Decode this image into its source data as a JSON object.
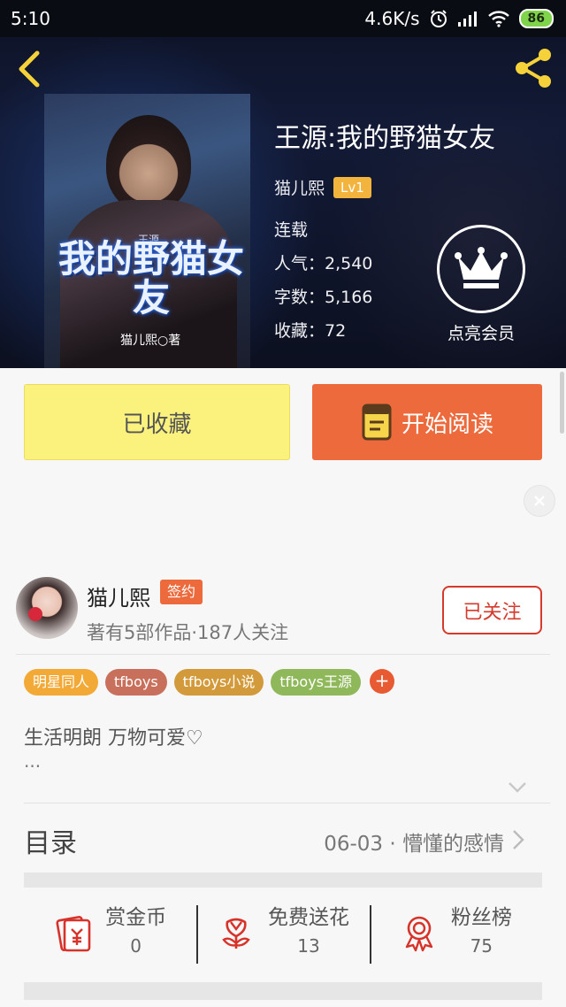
{
  "status_bar": {
    "time": "5:10",
    "network_speed": "4.6K/s",
    "battery": "86"
  },
  "book": {
    "cover_subtitle": "王源",
    "cover_title": "我的野猫女友",
    "cover_author": "猫儿熙○著",
    "title": "王源:我的野猫女友",
    "author": "猫儿熙",
    "level": "Lv1",
    "status": "连载",
    "popularity": "人气：2,540",
    "word_count": "字数：5,166",
    "favorites": "收藏：72"
  },
  "vip": {
    "label": "点亮会员"
  },
  "actions": {
    "collected_label": "已收藏",
    "read_label": "开始阅读"
  },
  "author_card": {
    "name": "猫儿熙",
    "badge": "签约",
    "stats": "著有5部作品·187人关注",
    "follow_label": "已关注"
  },
  "tags": [
    {
      "label": "明星同人",
      "color": "#f3a935"
    },
    {
      "label": "tfboys",
      "color": "#c9705c"
    },
    {
      "label": "tfboys小说",
      "color": "#d29a3a"
    },
    {
      "label": "tfboys王源",
      "color": "#8fb85a"
    }
  ],
  "tag_more": "+",
  "bio": {
    "text": "生活明朗 万物可爱♡",
    "more": "..."
  },
  "toc": {
    "label": "目录",
    "latest": "06-03 · 懵懂的感情"
  },
  "stats": [
    {
      "label": "赏金币",
      "value": "0",
      "icon": "red-envelope-icon"
    },
    {
      "label": "免费送花",
      "value": "13",
      "icon": "flower-icon"
    },
    {
      "label": "粉丝榜",
      "value": "75",
      "icon": "medal-icon"
    }
  ],
  "colors": {
    "accent_orange": "#ec6a3c",
    "collected_yellow": "#fbf27e",
    "follow_red": "#d63a2c",
    "level_badge": "#f3b43e"
  }
}
